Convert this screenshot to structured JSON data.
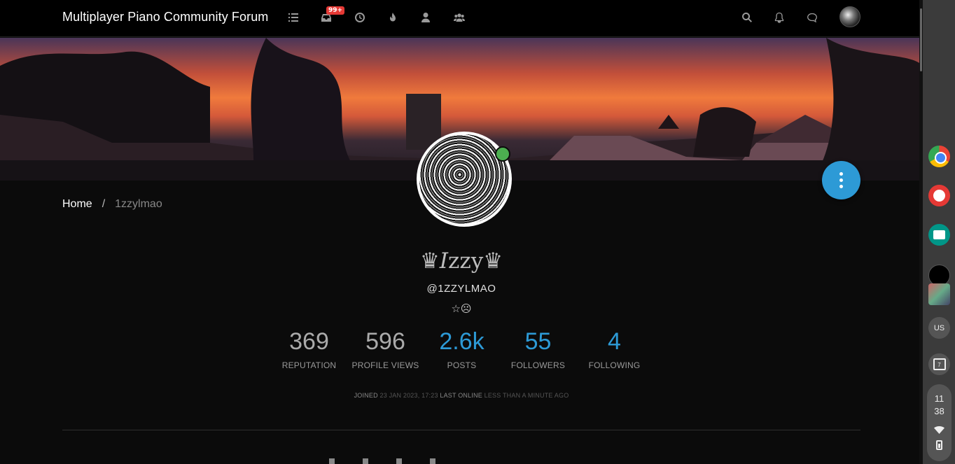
{
  "navbar": {
    "brand": "Multiplayer Piano Community Forum",
    "unread_badge": "99+"
  },
  "breadcrumb": {
    "home": "Home",
    "separator": "/",
    "current": "1zzylmao"
  },
  "profile": {
    "fullname_prefix": "♛",
    "fullname_italic": "I",
    "fullname_rest": "zzy",
    "fullname_suffix": "♛",
    "username": "@1ZZYLMAO",
    "signature": "☆☹",
    "stats": [
      {
        "value": "369",
        "label": "REPUTATION"
      },
      {
        "value": "596",
        "label": "PROFILE VIEWS"
      },
      {
        "value": "2.6k",
        "label": "POSTS"
      },
      {
        "value": "55",
        "label": "FOLLOWERS"
      },
      {
        "value": "4",
        "label": "FOLLOWING"
      }
    ],
    "joined_label": "JOINED",
    "joined_value": "23 JAN 2023, 17:23",
    "last_online_label": "LAST ONLINE",
    "last_online_value": "LESS THAN A MINUTE AGO"
  },
  "shelf": {
    "ime": "US",
    "calendar_day": "7",
    "clock_hour": "11",
    "clock_minute": "38"
  },
  "colors": {
    "accent": "#2d9ad6",
    "online": "#4caf50",
    "badge": "#e53935",
    "background": "#0b0b0b"
  }
}
